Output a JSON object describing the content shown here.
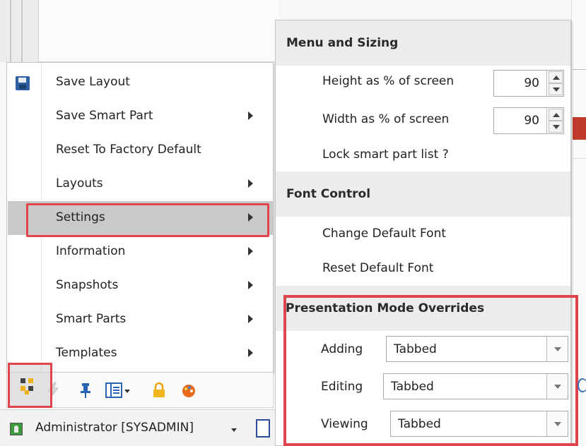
{
  "menu": {
    "items": [
      {
        "label": "Save Layout",
        "submenu": false,
        "icon": "floppy-disk-icon"
      },
      {
        "label": "Save Smart Part",
        "submenu": true
      },
      {
        "label": "Reset To Factory Default",
        "submenu": false
      },
      {
        "label": "Layouts",
        "submenu": true
      },
      {
        "label": "Settings",
        "submenu": true,
        "active": true
      },
      {
        "label": "Information",
        "submenu": true
      },
      {
        "label": "Snapshots",
        "submenu": true
      },
      {
        "label": "Smart Parts",
        "submenu": true
      },
      {
        "label": "Templates",
        "submenu": true
      }
    ]
  },
  "toolbar": {
    "icons": [
      "layout-menu-icon",
      "lightning-icon",
      "pin-icon",
      "column-layout-icon",
      "lock-icon",
      "palette-icon"
    ]
  },
  "status": {
    "user_label": "Administrator [SYSADMIN]",
    "user_icon": "user-icon",
    "grid_icon": "grid-icon"
  },
  "panel": {
    "menu_sizing": {
      "title": "Menu and Sizing",
      "height_label": "Height as % of screen",
      "height_value": "90",
      "width_label": "Width as % of screen",
      "width_value": "90",
      "lock_label": "Lock smart part list ?"
    },
    "font_control": {
      "title": "Font Control",
      "change_label": "Change Default Font",
      "reset_label": "Reset Default Font"
    },
    "overrides": {
      "title": "Presentation Mode Overrides",
      "adding_label": "Adding",
      "adding_value": "Tabbed",
      "editing_label": "Editing",
      "editing_value": "Tabbed",
      "viewing_label": "Viewing",
      "viewing_value": "Tabbed"
    }
  },
  "colors": {
    "highlight": "#e0454e",
    "section_header_bg": "#ececec",
    "active_item_bg": "#c9c9c9"
  }
}
